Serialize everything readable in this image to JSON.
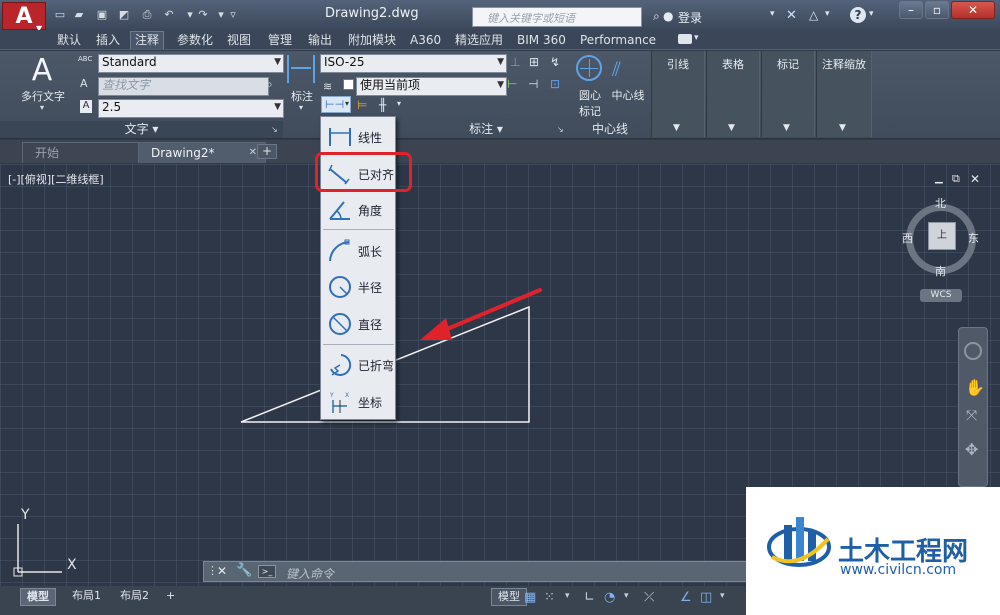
{
  "title_bar": {
    "logo": "A",
    "document_title": "Drawing2.dwg",
    "search_placeholder": "键入关键字或短语",
    "login_label": "登录",
    "help_label": "?"
  },
  "ribbon_tabs": [
    "默认",
    "插入",
    "注释",
    "参数化",
    "视图",
    "管理",
    "输出",
    "附加模块",
    "A360",
    "精选应用",
    "BIM 360",
    "Performance"
  ],
  "active_tab": "注释",
  "ribbon": {
    "text_group": {
      "big_button_label": "多行文字",
      "style_value": "Standard",
      "find_placeholder": "查找文字",
      "height_value": "2.5",
      "group_title": "文字"
    },
    "dim_group": {
      "big_button_label": "标注",
      "dimstyle_value": "ISO-25",
      "layer_value": "使用当前项",
      "group_title": "标注"
    },
    "centerline_group": {
      "center_mark_label": "圆心标记",
      "centerline_label": "中心线",
      "group_title": "中心线"
    },
    "side_groups": [
      "引线",
      "表格",
      "标记",
      "注释缩放"
    ]
  },
  "doc_tabs": {
    "start": "开始",
    "active": "Drawing2*",
    "add": "+"
  },
  "viewport_label": "[-][俯视][二维线框]",
  "viewcube": {
    "north": "北",
    "south": "南",
    "west": "西",
    "east": "东",
    "wcs": "WCS"
  },
  "dim_menu": {
    "items": [
      "线性",
      "已对齐",
      "角度",
      "弧长",
      "半径",
      "直径",
      "已折弯",
      "坐标"
    ],
    "highlighted": "已对齐"
  },
  "ucs": {
    "x": "X",
    "y": "Y"
  },
  "command_line": {
    "placeholder": "键入命令"
  },
  "layout_tabs": [
    "模型",
    "布局1",
    "布局2"
  ],
  "status_bar": {
    "model_label": "模型"
  },
  "watermark": {
    "brand": "土木工程网",
    "url": "www.civilcn.com"
  },
  "colors": {
    "annotation_red": "#e0222b",
    "logo_red": "#b9252b",
    "canvas_bg": "#2d3748",
    "watermark_blue": "#1f5fa8"
  },
  "icons": [
    "new-file-icon",
    "open-icon",
    "save-icon",
    "saveas-icon",
    "print-icon",
    "undo-icon",
    "redo-icon",
    "binoculars-icon",
    "user-icon",
    "exchange-icon",
    "a360-icon",
    "help-icon",
    "minimize-icon",
    "maximize-icon",
    "close-icon",
    "pan-hand-icon",
    "zoom-icon",
    "orbit-icon",
    "grid-icon",
    "snap-icon",
    "ortho-icon",
    "polar-icon"
  ]
}
